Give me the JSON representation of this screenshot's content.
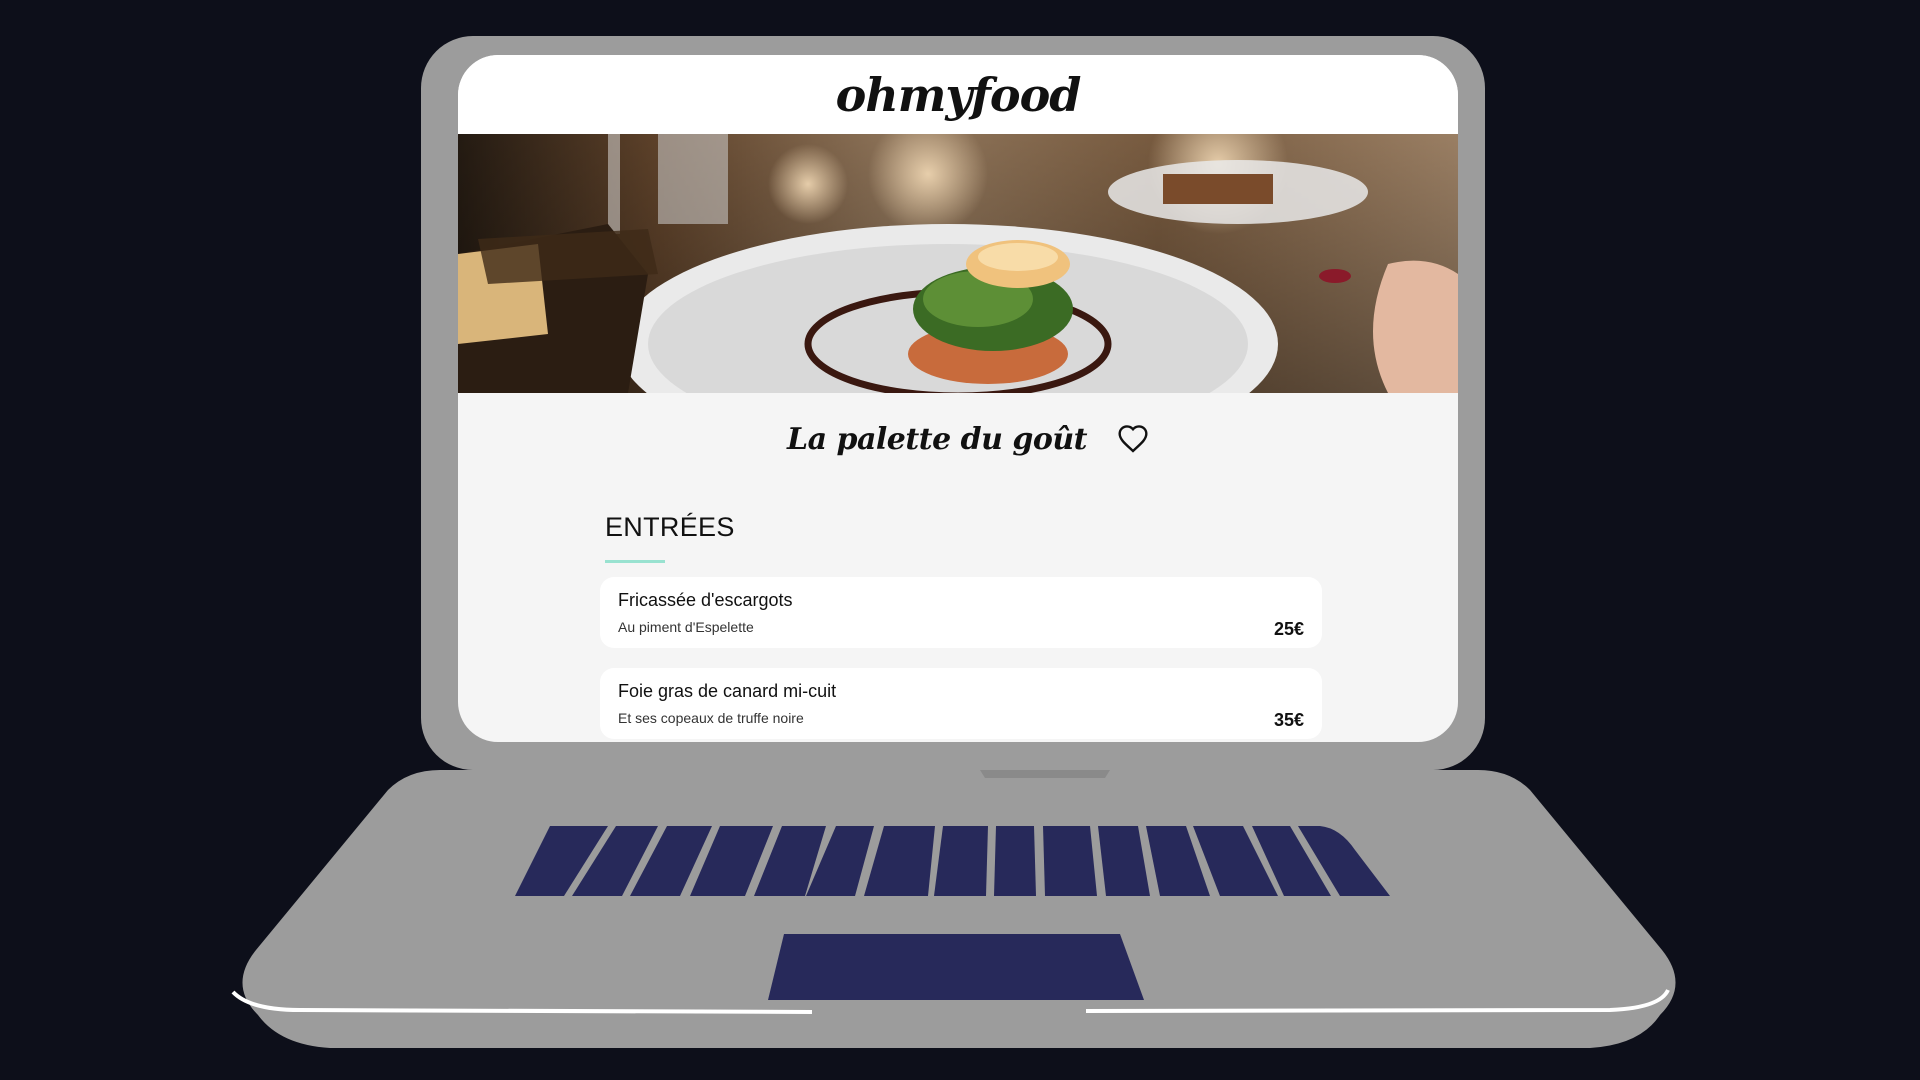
{
  "site": {
    "logo": "ohmyfood"
  },
  "restaurant": {
    "name": "La palette du goût"
  },
  "menu": {
    "section_title": "ENTRÉES",
    "items": [
      {
        "name": "Fricassée d'escargots",
        "description": "Au piment d'Espelette",
        "price": "25€"
      },
      {
        "name": "Foie gras de canard mi-cuit",
        "description": "Et ses copeaux de truffe noire",
        "price": "35€"
      }
    ]
  },
  "colors": {
    "background": "#0d0f1a",
    "laptop_body": "#9c9c9c",
    "keyboard": "#27295a",
    "accent_underline": "#99e2d0"
  },
  "icons": {
    "favorite": "heart-icon"
  }
}
